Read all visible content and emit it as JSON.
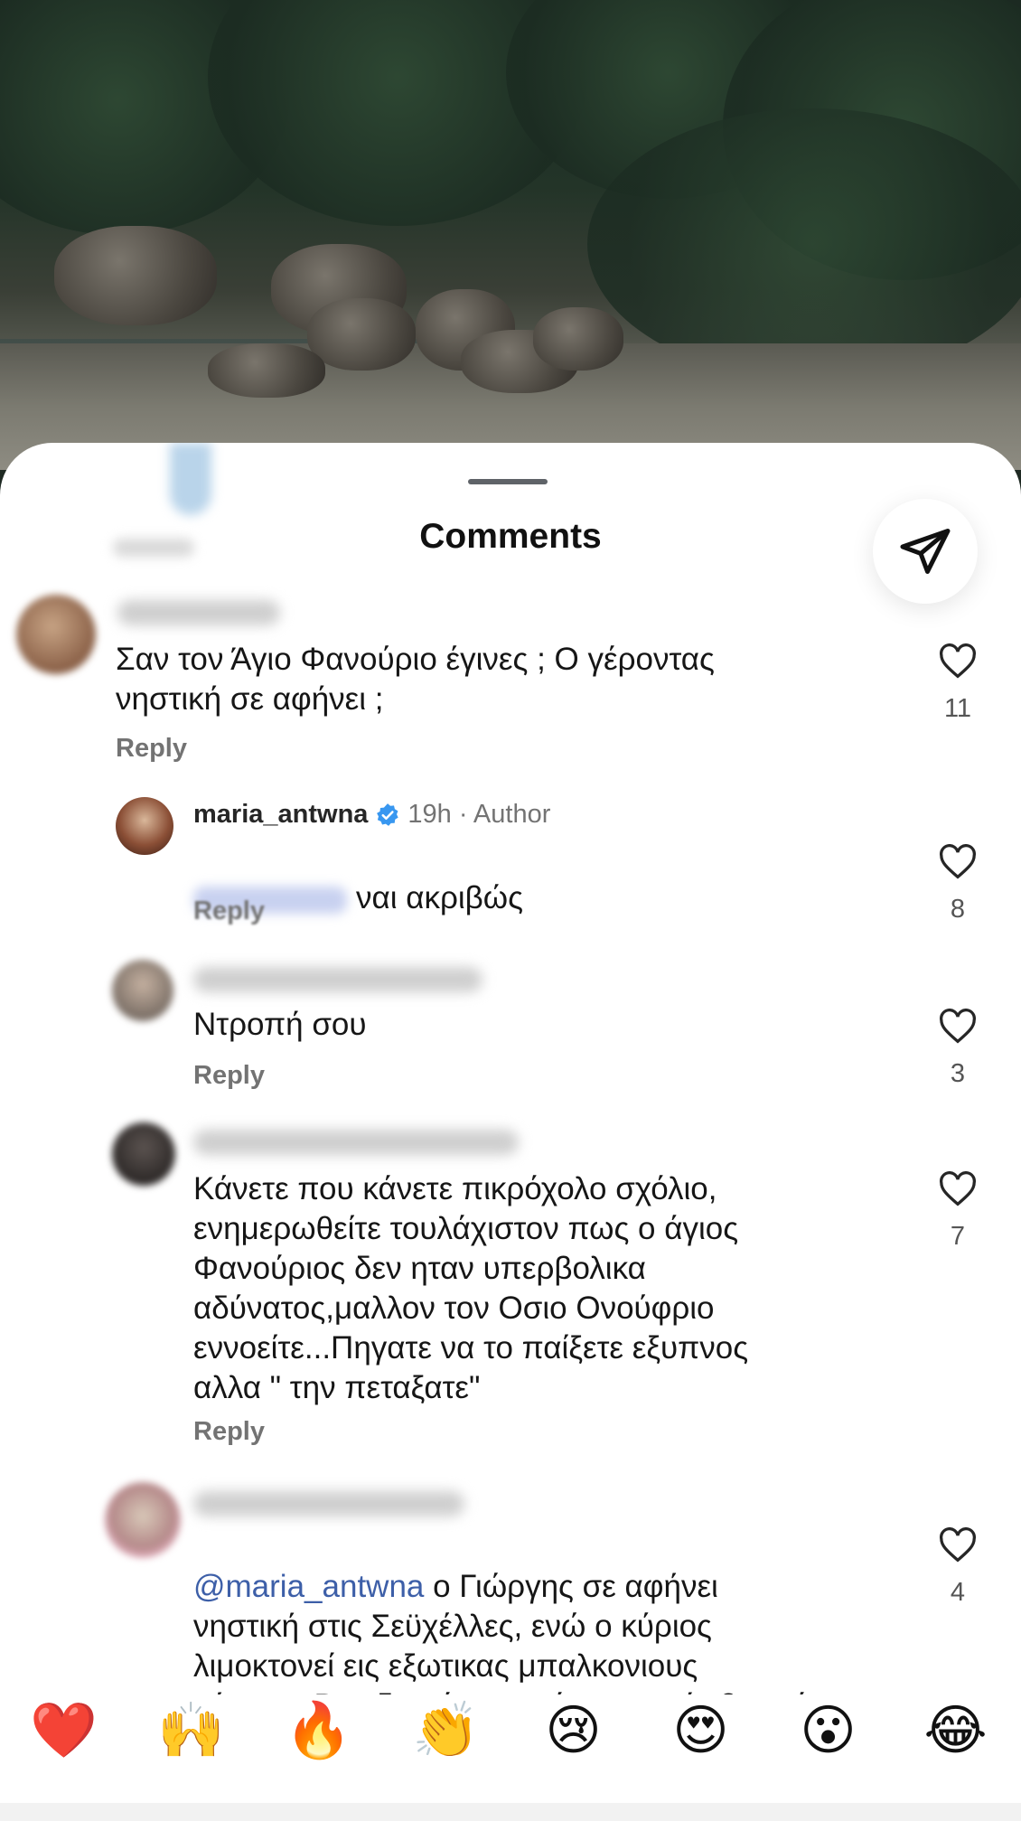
{
  "sheet": {
    "title": "Comments",
    "share_icon": "send-icon"
  },
  "comments": [
    {
      "text": "Σαν τον Άγιο Φανούριο έγινες ; Ο γέροντας\nνηστική σε αφήνει ;",
      "reply_label": "Reply",
      "likes": "11"
    },
    {
      "username": "maria_antwna",
      "verified": true,
      "time": "19h",
      "role": "· Author",
      "text": "ναι ακριβώς",
      "reply_label": "Reply",
      "likes": "8"
    },
    {
      "text": "Ντροπή σου",
      "reply_label": "Reply",
      "likes": "3"
    },
    {
      "text": "Κάνετε που κάνετε πικρόχολο σχόλιο,\nενημερωθείτε τουλάχιστον πως ο άγιος\nΦανούριος δεν ηταν υπερβολικα\nαδύνατος,μαλλον τον Οσιο Ονούφριο\nεννοείτε...Πηγατε να το παίξετε εξυπνος\nαλλα \" την πεταξατε\"",
      "reply_label": "Reply",
      "likes": "7"
    },
    {
      "mention": "@maria_antwna",
      "text_first_line": " ο Γιώργης σε αφήνει",
      "text_rest": "νηστική στις Σεϋχέλλες, ενώ ο κύριος\nλιμοκτονεί εις εξωτικας μπαλκονιους\nνήσους. Βρε δε πάτε να κάνετε καμία βουτιά",
      "likes": "4"
    }
  ],
  "emoji_bar": [
    "❤️",
    "🙌",
    "🔥",
    "👏",
    "😢",
    "😍",
    "😮",
    "😂"
  ],
  "colors": {
    "mention": "#3d5fa8",
    "verified": "#3897f0",
    "reply": "#737373"
  }
}
